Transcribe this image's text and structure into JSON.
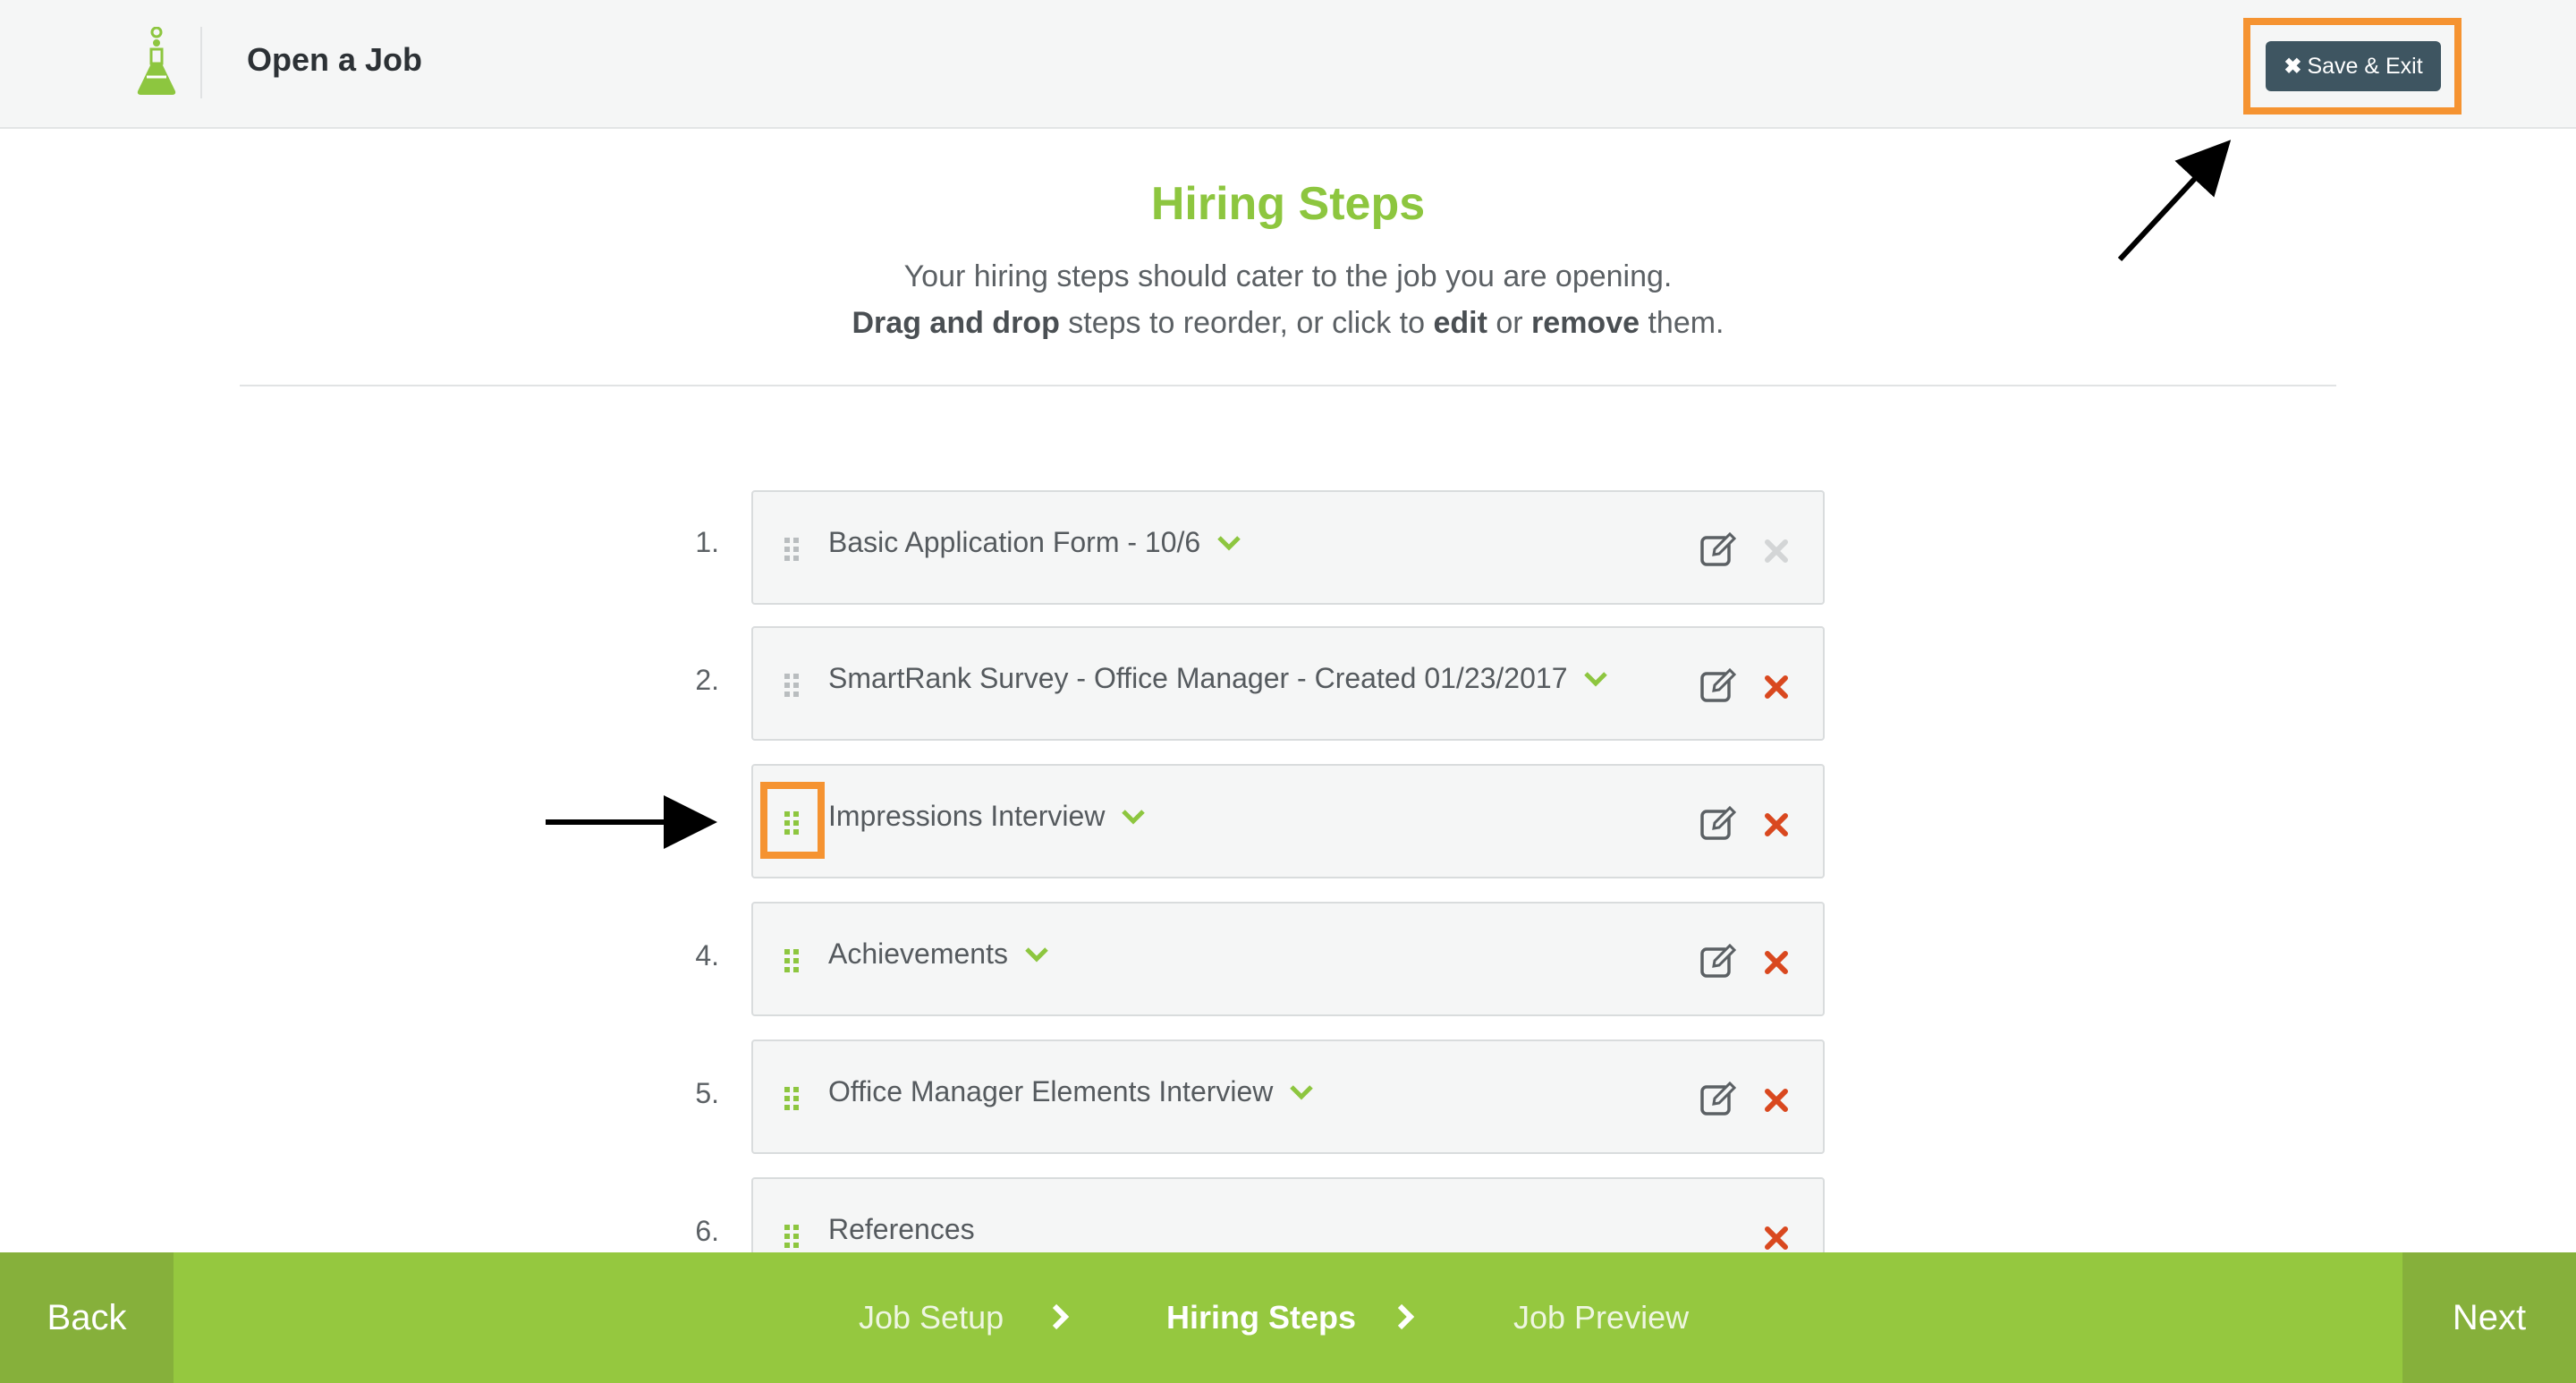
{
  "header": {
    "title": "Open a Job",
    "save_exit_label": "Save & Exit"
  },
  "intro": {
    "title": "Hiring Steps",
    "line1": "Your hiring steps should cater to the job you are opening.",
    "line2": {
      "drag": "Drag and drop",
      "mid1": " steps to reorder, or click to ",
      "edit": "edit",
      "mid2": " or ",
      "remove": "remove",
      "end": " them."
    }
  },
  "steps": [
    {
      "number": "1.",
      "label": "Basic Application Form - 10/6",
      "removable": false,
      "editable": true
    },
    {
      "number": "2.",
      "label": "SmartRank Survey - Office Manager - Created 01/23/2017",
      "removable": true,
      "editable": true
    },
    {
      "number": "",
      "label": "Impressions Interview",
      "removable": true,
      "editable": true
    },
    {
      "number": "4.",
      "label": "Achievements",
      "removable": true,
      "editable": true
    },
    {
      "number": "5.",
      "label": "Office Manager Elements Interview",
      "removable": true,
      "editable": true
    },
    {
      "number": "6.",
      "label": "References",
      "removable": true,
      "editable": false
    }
  ],
  "footer": {
    "back_label": "Back",
    "next_label": "Next",
    "crumbs": [
      {
        "label": "Job Setup",
        "active": false
      },
      {
        "label": "Hiring Steps",
        "active": true
      },
      {
        "label": "Job Preview",
        "active": false
      }
    ]
  },
  "colors": {
    "accent_green": "#8dc63f",
    "footer_green": "#95c83f",
    "footer_dark_green": "#86b03b",
    "button_slate": "#3e5561",
    "remove_red": "#d9481f",
    "highlight_orange": "#f59331"
  },
  "icons": {
    "logo": "flask-logo-icon",
    "save_exit": "close-icon",
    "drag": "drag-handle-icon",
    "expand": "chevron-down-icon",
    "edit": "edit-icon",
    "remove": "remove-x-icon",
    "crumb_separator": "chevron-right-icon"
  }
}
